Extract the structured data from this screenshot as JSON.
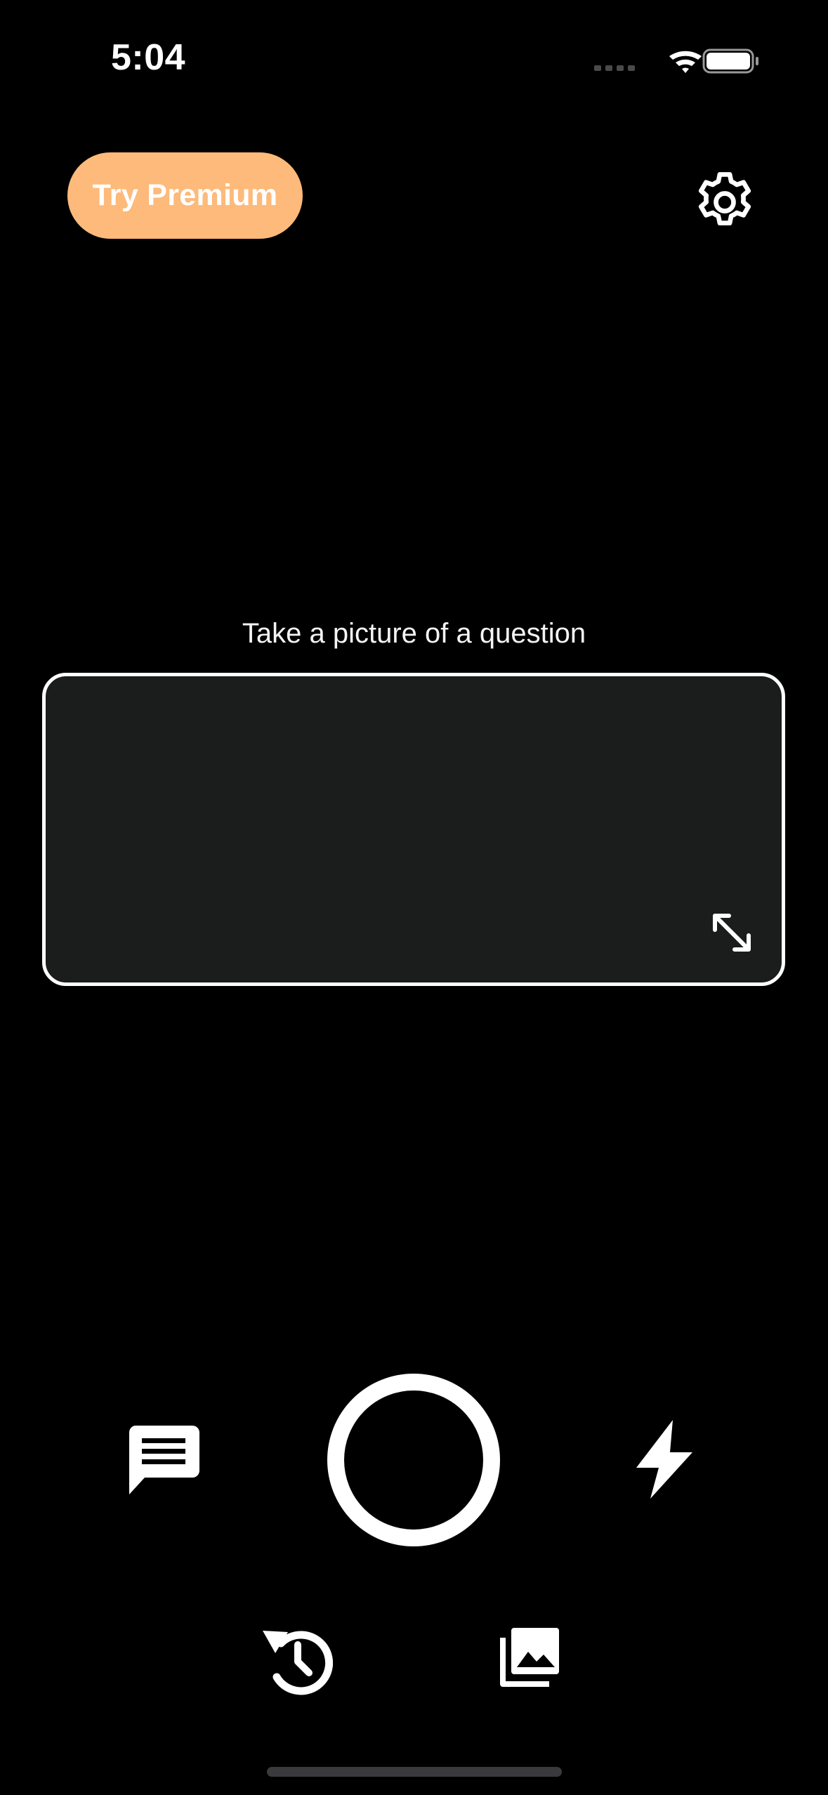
{
  "status_bar": {
    "time": "5:04",
    "icons": [
      "signal-icon",
      "wifi-icon",
      "battery-icon"
    ]
  },
  "header": {
    "premium_label": "Try Premium",
    "settings_icon": "gear-icon"
  },
  "capture": {
    "prompt": "Take a picture of a question",
    "expand_icon": "expand-arrows-icon"
  },
  "controls": {
    "chat_icon": "chat-bubble-icon",
    "shutter_icon": "shutter-ring",
    "flash_icon": "flash-icon",
    "history_icon": "history-icon",
    "gallery_icon": "photo-library-icon"
  },
  "colors": {
    "background": "#000000",
    "premium_accent": "#FDBA7A",
    "frame_fill": "#1B1C1C",
    "foreground": "#FFFFFF"
  }
}
